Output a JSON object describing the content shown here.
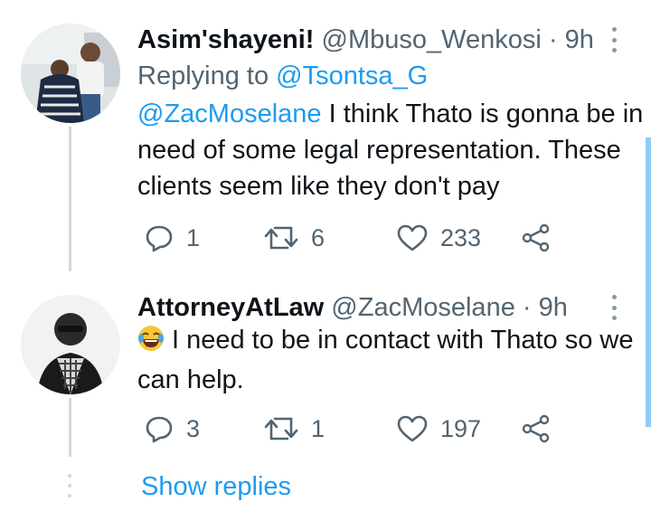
{
  "tweets": [
    {
      "name": "Asim'shayeni!",
      "handle": "@Mbuso_Wenkosi",
      "separator": "·",
      "time": "9h",
      "replying_prefix": "Replying to ",
      "replying_to": "@Tsontsa_G",
      "mention": "@ZacMoselane",
      "text": " I think Thato is gonna be in need of some legal representation. These clients seem like they don't pay",
      "replies": "1",
      "retweets": "6",
      "likes": "233"
    },
    {
      "name": "AttorneyAtLaw",
      "handle": "@ZacMoselane",
      "separator": "·",
      "time": "9h",
      "emoji": "face-with-tears-of-joy",
      "text": "I need to be in contact with Thato so we can help.",
      "replies": "3",
      "retweets": "1",
      "likes": "197"
    }
  ],
  "show_replies": "Show replies",
  "colors": {
    "accent": "#1d9bf0",
    "secondary_text": "#536471",
    "thread_line": "#cfd9de"
  }
}
